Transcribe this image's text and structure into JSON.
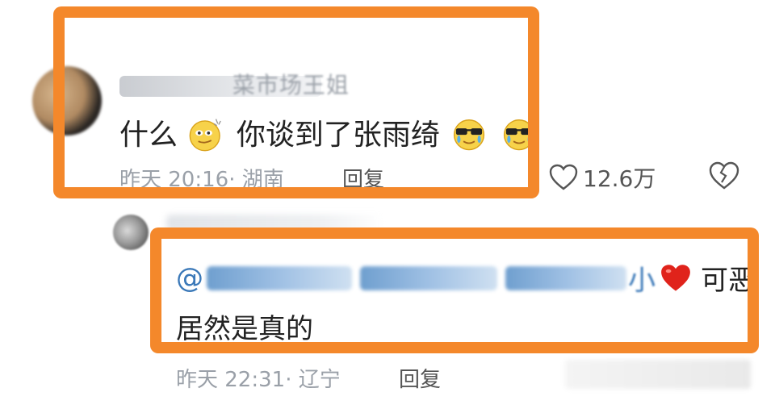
{
  "comment1": {
    "username_suffix": "菜市场王姐",
    "text_part1": "什么",
    "text_part2": "你谈到了张雨绮",
    "time": "昨天 20:16· 湖南",
    "reply_label": "回复",
    "like_count": "12.6万",
    "icons": [
      "smirk-emoji",
      "cool-crying-emoji",
      "cool-crying-emoji",
      "heart-outline-icon",
      "broken-heart-icon"
    ]
  },
  "comment2": {
    "mention_prefix": "@",
    "mention_tail": "小",
    "text_after_heart": "可恶",
    "text_line2": "居然是真的",
    "time": "昨天 22:31· 辽宁",
    "reply_label": "回复",
    "icons": [
      "red-heart-emoji"
    ]
  },
  "colors": {
    "highlight_frame": "#f4882b",
    "mention": "#3a78b8",
    "meta": "#9aa0a8"
  }
}
